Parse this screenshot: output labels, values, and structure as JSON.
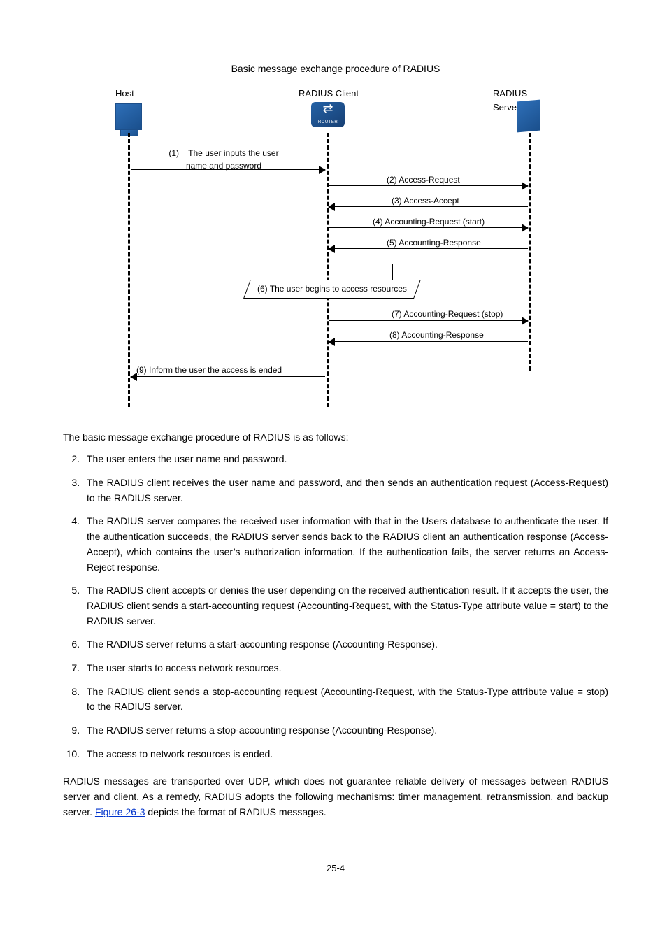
{
  "figure": {
    "caption": "Basic message exchange procedure of RADIUS",
    "nodes": {
      "host_label": "Host",
      "client_label": "RADIUS Client",
      "server_label": "RADIUS Server",
      "client_icon_text": "ROUTER"
    },
    "messages": {
      "m1": "(1)    The user inputs the user\nname and password",
      "m2": "(2)    Access-Request",
      "m3": "(3)    Access-Accept",
      "m4": "(4)    Accounting-Request (start)",
      "m5": "(5)   Accounting-Response",
      "m6": "(6)    The user begins to access resources",
      "m7": "(7) Accounting-Request (stop)",
      "m8": "(8)   Accounting-Response",
      "m9": "(9)   Inform the user the access is ended"
    }
  },
  "intro_line": "The basic message exchange procedure of RADIUS is as follows:",
  "steps": {
    "s2": "The user enters the user name and password.",
    "s3": "The RADIUS client receives the user name and password, and then sends an authentication request (Access-Request) to the RADIUS server.",
    "s4": "The RADIUS server compares the received user information with that in the Users database to authenticate the user. If the authentication succeeds, the RADIUS server sends back to the RADIUS client an authentication response (Access-Accept), which contains the user’s authorization information. If the authentication fails, the server returns an Access-Reject response.",
    "s5": "The RADIUS client accepts or denies the user depending on the received authentication result. If it accepts the user, the RADIUS client sends a start-accounting request (Accounting-Request, with the Status-Type attribute value = start) to the RADIUS server.",
    "s6": "The RADIUS server returns a start-accounting response (Accounting-Response).",
    "s7": "The user starts to access network resources.",
    "s8": "The RADIUS client sends a stop-accounting request (Accounting-Request, with the Status-Type attribute value = stop) to the RADIUS server.",
    "s9": "The RADIUS server returns a stop-accounting response (Accounting-Response).",
    "s10": "The access to network resources is ended."
  },
  "closing": {
    "before_ref": "RADIUS messages are transported over UDP, which does not guarantee reliable delivery of messages between RADIUS server and client. As a remedy, RADIUS adopts the following mechanisms: timer management, retransmission, and backup server. ",
    "ref_text": "Figure 26-3",
    "after_ref": " depicts the format of RADIUS messages."
  },
  "page_number": "25-4"
}
